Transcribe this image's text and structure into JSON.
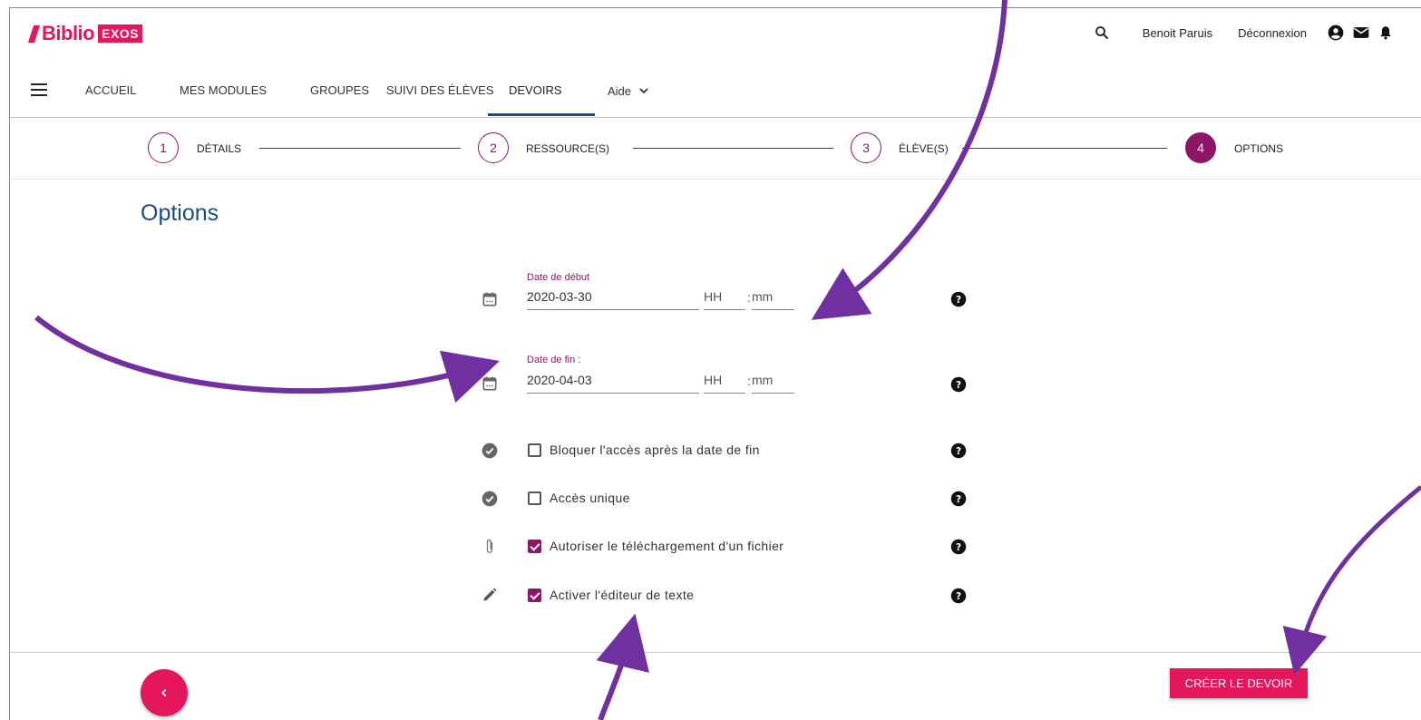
{
  "brand": {
    "name": "Biblio",
    "badge": "EXOS"
  },
  "header": {
    "user_name": "Benoit Paruis",
    "logout": "Déconnexion"
  },
  "nav": {
    "items": [
      {
        "label": "ACCUEIL"
      },
      {
        "label": "MES MODULES"
      },
      {
        "label": "GROUPES"
      },
      {
        "label": "SUIVI DES ÉLÈVES"
      },
      {
        "label": "DEVOIRS"
      }
    ],
    "aide": "Aide",
    "active": "DEVOIRS"
  },
  "stepper": {
    "steps": [
      {
        "number": "1",
        "label": "DÉTAILS"
      },
      {
        "number": "2",
        "label": "RESSOURCE(S)"
      },
      {
        "number": "3",
        "label": "ÉLÈVE(S)"
      },
      {
        "number": "4",
        "label": "OPTIONS"
      }
    ],
    "active_step": 4
  },
  "page": {
    "title": "Options"
  },
  "form": {
    "start": {
      "label": "Date de début",
      "date": "2020-03-30",
      "hh_placeholder": "HH",
      "mm_placeholder": "mm"
    },
    "end": {
      "label": "Date de fin :",
      "date": "2020-04-03",
      "hh_placeholder": "HH",
      "mm_placeholder": "mm"
    },
    "options": [
      {
        "label": "Bloquer l'accès après la date de fin",
        "checked": false,
        "icon": "check-circle-icon"
      },
      {
        "label": "Accès unique",
        "checked": false,
        "icon": "check-circle-icon"
      },
      {
        "label": "Autoriser le téléchargement d'un fichier",
        "checked": true,
        "icon": "paperclip-icon"
      },
      {
        "label": "Activer l'éditeur de texte",
        "checked": true,
        "icon": "pencil-icon"
      }
    ]
  },
  "footer": {
    "create_button": "CRÉER LE DEVOIR"
  },
  "colors": {
    "brand_pink": "#e4165d",
    "accent_purple": "#8e1669",
    "title_blue": "#1c4b80",
    "annotation_arrow": "#7030a0"
  }
}
